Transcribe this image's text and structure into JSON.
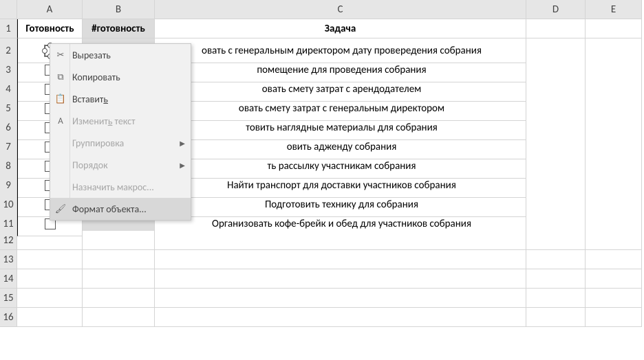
{
  "columns": [
    "A",
    "B",
    "C",
    "D",
    "E"
  ],
  "headers": {
    "A": "Готовность",
    "B": "#готовность",
    "C": "Задача"
  },
  "rows": [
    {
      "n": 2,
      "task": "овать с генеральным директором дату провередения собрания"
    },
    {
      "n": 3,
      "task": "помещение для проведения собрания"
    },
    {
      "n": 4,
      "task": "овать смету затрат с арендодателем"
    },
    {
      "n": 5,
      "task": "овать смету затрат с генеральным директором"
    },
    {
      "n": 6,
      "task": "товить наглядные материалы для собрания"
    },
    {
      "n": 7,
      "task": "овить адженду собрания"
    },
    {
      "n": 8,
      "task": "ть рассылку участникам собрания"
    },
    {
      "n": 9,
      "task": "Найти транспорт для доставки участников собрания"
    },
    {
      "n": 10,
      "task": "Подготовить технику для собрания"
    },
    {
      "n": 11,
      "task": "Организовать кофе-брейк и обед для участников собрания"
    }
  ],
  "empty_rows": [
    12,
    13,
    14,
    15,
    16
  ],
  "context_menu": {
    "cut": "Вырезать",
    "copy": "Копировать",
    "paste": "Вставить",
    "paste_u": "ь",
    "edit_text": "Изменить текст",
    "edit_text_u": "ь",
    "group": "Группировка",
    "order": "Порядок",
    "assign_macro": "Назначить макрос...",
    "format_object": "Формат объекта..."
  }
}
